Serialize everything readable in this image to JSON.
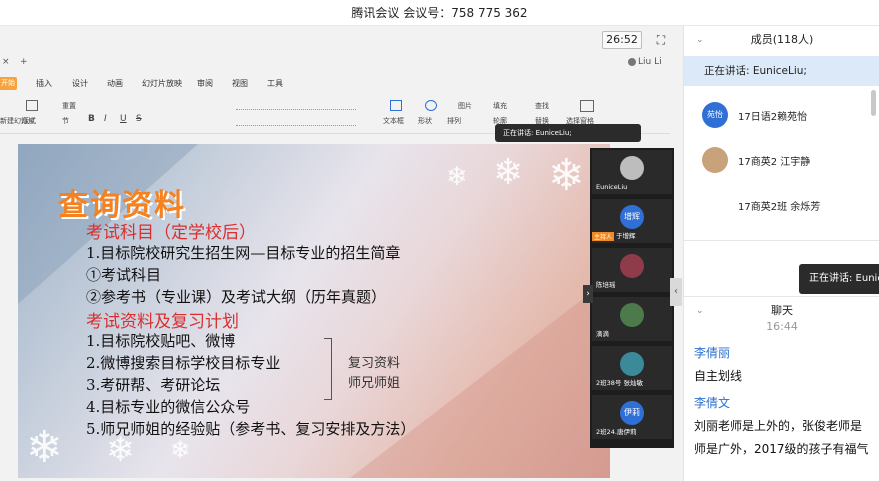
{
  "window": {
    "title": "腾讯会议 会议号：758 775 362"
  },
  "meeting": {
    "timer": "26:52",
    "fullscreen_icon": "fullscreen-icon"
  },
  "wps": {
    "tab_close": "×",
    "tab_add": "+",
    "user": "Liu Li",
    "ribbon_tabs": [
      "开始",
      "插入",
      "设计",
      "动画",
      "幻灯片放映",
      "审阅",
      "视图",
      "工具"
    ],
    "toolbar": {
      "new_slide": "新建幻灯片",
      "layout": "版式",
      "reset": "重置",
      "section": "节",
      "textbox": "文本框",
      "shape": "形状",
      "arrange": "排列",
      "picture": "图片",
      "fill": "填充",
      "find": "查找",
      "replace": "替换",
      "outline": "轮廓",
      "select_pane": "选择窗格",
      "bold": "B",
      "italic": "I",
      "underline": "U",
      "strike": "S"
    }
  },
  "slide": {
    "title": "查询资料",
    "section1": "考试科目（定学校后）",
    "line1": "1.目标院校研究生招生网—目标专业的招生简章",
    "line2": "①考试科目",
    "line3": "②参考书（专业课）及考试大纲（历年真题）",
    "section2": "考试资料及复习计划",
    "line4": "1.目标院校贴吧、微博",
    "line5": "2.微博搜索目标学校目标专业",
    "line6": "3.考研帮、考研论坛",
    "line7": "4.目标专业的微信公众号",
    "line8": "5.师兄师姐的经验贴（参考书、复习安排及方法）",
    "side1": "复习资料",
    "side2": "师兄师姐"
  },
  "speaking_pill": "正在讲话: EuniceLiu;",
  "video_tiles": [
    {
      "name": "EuniceLiu",
      "avatar": "",
      "color": "#8a8a8a"
    },
    {
      "name": "于增辉",
      "avatar": "增辉",
      "color": "#2f6fd6",
      "host_tag": "主持人"
    },
    {
      "name": "陈培瑶",
      "avatar": "",
      "color": "#8e3b4a"
    },
    {
      "name": "滴滴",
      "avatar": "",
      "color": "#4d7a4a"
    },
    {
      "name": "2班38号 张灿敏",
      "avatar": "",
      "color": "#3a8a9a"
    },
    {
      "name": "2班24.唐伊莉",
      "avatar": "伊莉",
      "color": "#2f6fd6"
    }
  ],
  "members": {
    "header": "成员(118人)",
    "now_speaking": "正在讲话: EuniceLiu;",
    "list": [
      {
        "name": "17日语2赖苑怡",
        "avatar": "苑怡",
        "color": "#2f6fd6"
      },
      {
        "name": "17商英2 江宇静",
        "avatar": "",
        "color": "#c8a27a"
      },
      {
        "name": "17商英2班 余烁芳",
        "avatar": "",
        "color": ""
      }
    ],
    "speak_tip": "正在讲话: Eunic"
  },
  "chat": {
    "header": "聊天",
    "time": "16:44",
    "messages": [
      {
        "sender": "李倩丽",
        "text": "自主划线"
      },
      {
        "sender": "李倩文",
        "text": "刘丽老师是上外的，张俊老师是",
        "text2": "师是广外，2017级的孩子有福气"
      }
    ]
  }
}
